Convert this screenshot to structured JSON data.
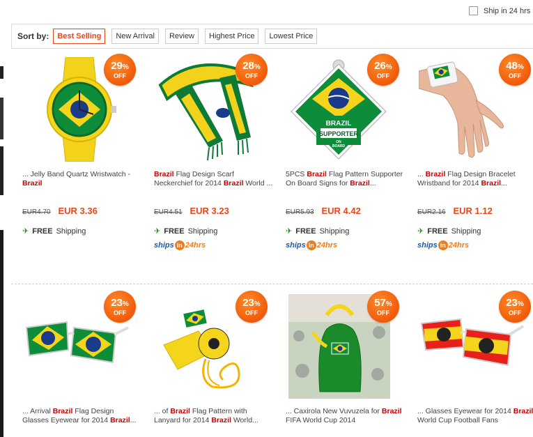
{
  "ship_filter": {
    "label": "Ship in 24 hrs",
    "checked": false
  },
  "sort_bar": {
    "label": "Sort by:",
    "options": [
      "Best Selling",
      "New Arrival",
      "Review",
      "Highest Price",
      "Lowest Price"
    ],
    "active": "Best Selling"
  },
  "colors": {
    "accent": "#e8471b",
    "brand_red": "#cc0000",
    "badge_orange": "#f05a0a",
    "ship_blue": "#1a5aa8",
    "ship_green": "#2a8a2a"
  },
  "products": [
    {
      "badge_pct": "29",
      "badge_off": "OFF",
      "pct_sign": "%",
      "title": [
        "... Jelly Band Quartz Wristwatch - ",
        "Brazil",
        ""
      ],
      "old_price": "EUR4.70",
      "new_price": "EUR 3.36",
      "shipping": {
        "free": "FREE",
        "text": "Shipping"
      },
      "ships24": null,
      "icon": "yellow-wristwatch"
    },
    {
      "badge_pct": "28",
      "badge_off": "OFF",
      "pct_sign": "%",
      "title": [
        "",
        "Brazil",
        " Flag Design Scarf Neckerchief for 2014 ",
        "Brazil",
        " World ..."
      ],
      "old_price": "EUR4.51",
      "new_price": "EUR 3.23",
      "shipping": {
        "free": "FREE",
        "text": "Shipping"
      },
      "ships24": {
        "a": "ships",
        "b": "in",
        "c": "24hrs"
      },
      "icon": "brazil-scarf"
    },
    {
      "badge_pct": "26",
      "badge_off": "OFF",
      "pct_sign": "%",
      "title": [
        "5PCS ",
        "Brazil",
        " Flag Pattern Supporter On Board Signs for ",
        "Brazil",
        "..."
      ],
      "old_price": "EUR5.93",
      "new_price": "EUR 4.42",
      "shipping": {
        "free": "FREE",
        "text": "Shipping"
      },
      "ships24": {
        "a": "ships",
        "b": "in",
        "c": "24hrs"
      },
      "icon": "supporter-sign",
      "sign_text": [
        "BRAZIL",
        "SUPPORTER",
        "ON",
        "BOARD"
      ]
    },
    {
      "badge_pct": "48",
      "badge_off": "OFF",
      "pct_sign": "%",
      "title": [
        "... ",
        "Brazil",
        " Flag Design Bracelet Wristband for 2014 ",
        "Brazil",
        "..."
      ],
      "old_price": "EUR2.16",
      "new_price": "EUR 1.12",
      "shipping": {
        "free": "FREE",
        "text": "Shipping"
      },
      "ships24": {
        "a": "ships",
        "b": "in",
        "c": "24hrs"
      },
      "icon": "bracelet-hand"
    },
    {
      "badge_pct": "23",
      "badge_off": "OFF",
      "pct_sign": "%",
      "title": [
        "... Arrival ",
        "Brazil",
        " Flag Design Glasses Eyewear for 2014 ",
        "Brazil",
        "..."
      ],
      "icon": "brazil-glasses"
    },
    {
      "badge_pct": "23",
      "badge_off": "OFF",
      "pct_sign": "%",
      "title": [
        "... of ",
        "Brazil",
        " Flag Pattern with Lanyard for 2014 ",
        "Brazil",
        " World..."
      ],
      "icon": "whistle-lanyard"
    },
    {
      "badge_pct": "57",
      "badge_off": "OFF",
      "pct_sign": "%",
      "title": [
        "... Caxirola New Vuvuzela for ",
        "Brazil",
        " FIFA World Cup 2014",
        "",
        ""
      ],
      "icon": "caxirola"
    },
    {
      "badge_pct": "23",
      "badge_off": "OFF",
      "pct_sign": "%",
      "title": [
        "... Glasses Eyewear for 2014 ",
        "Brazil",
        " World Cup Football Fans",
        "",
        ""
      ],
      "icon": "spain-glasses"
    }
  ]
}
